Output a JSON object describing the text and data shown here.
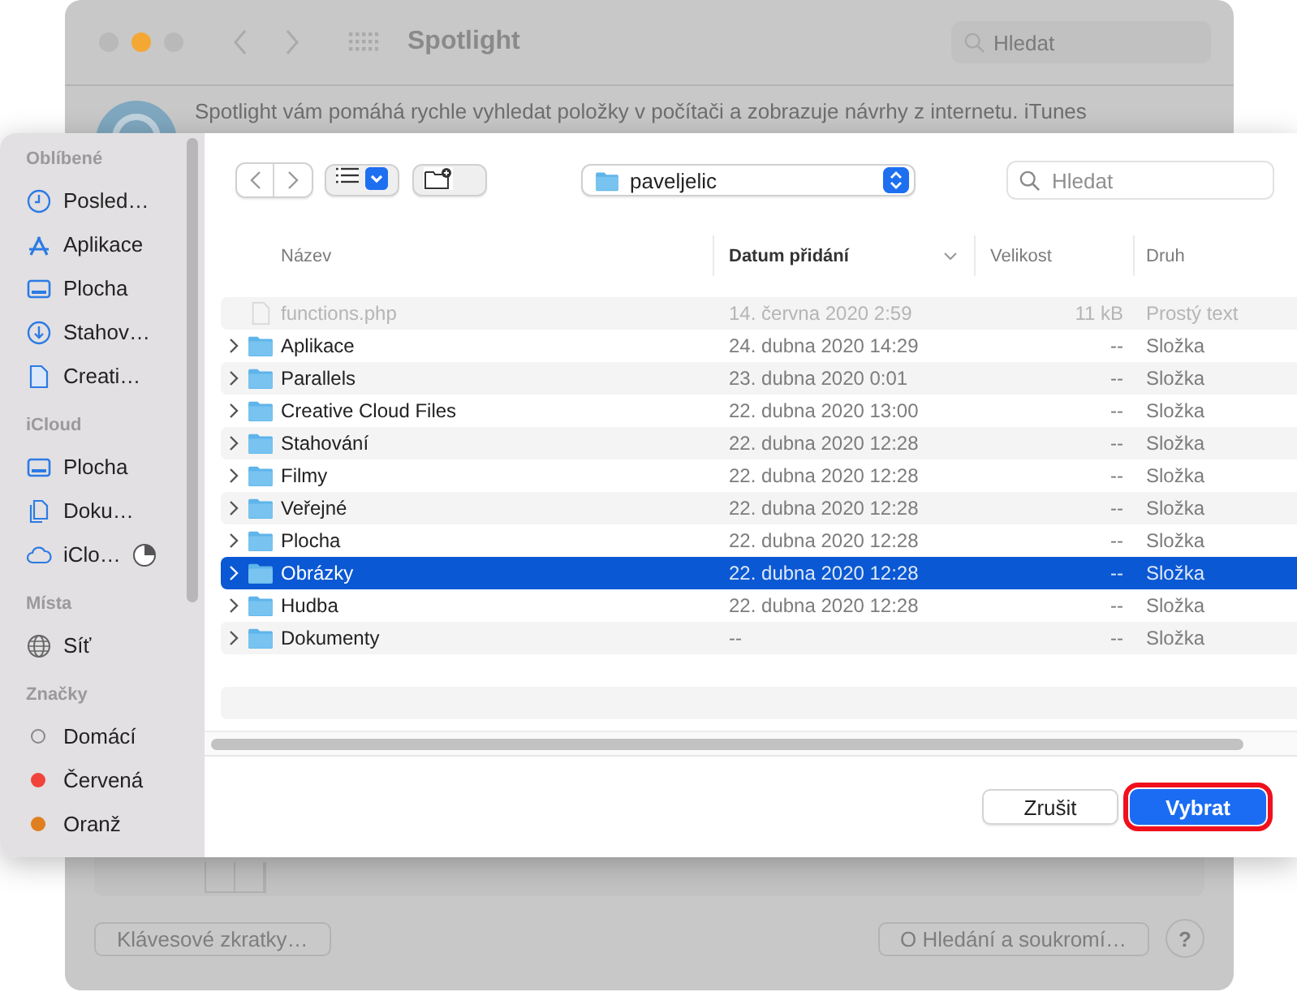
{
  "background_window": {
    "title": "Spotlight",
    "search": {
      "placeholder": "Hledat"
    },
    "description": "Spotlight vám pomáhá rychle vyhledat položky v počítači a zobrazuje návrhy z internetu. iTunes",
    "buttons": [
      "Klávesové zkratky…",
      "O Hledání a soukromí…"
    ],
    "help": "?"
  },
  "dialog": {
    "sidebar": {
      "sections": [
        {
          "title": "Oblíbené",
          "items": [
            {
              "label": "Posled…",
              "kind": "recent"
            },
            {
              "label": "Aplikace",
              "kind": "apps"
            },
            {
              "label": "Plocha",
              "kind": "desktop"
            },
            {
              "label": "Stahov…",
              "kind": "downloads"
            },
            {
              "label": "Creati…",
              "kind": "document"
            }
          ]
        },
        {
          "title": "iCloud",
          "items": [
            {
              "label": "Plocha",
              "kind": "desktop"
            },
            {
              "label": "Doku…",
              "kind": "documents"
            },
            {
              "label": "iClo…",
              "kind": "cloud"
            }
          ]
        },
        {
          "title": "Místa",
          "items": [
            {
              "label": "Síť",
              "kind": "network"
            }
          ]
        },
        {
          "title": "Značky",
          "items": [
            {
              "label": "Domácí",
              "kind": "tag"
            },
            {
              "label": "Červená",
              "kind": "tag",
              "color": "#f0443a"
            },
            {
              "label": "Oranž",
              "kind": "tag",
              "color": "#e07f1f"
            }
          ]
        }
      ]
    },
    "toolbar": {
      "location": "paveljelic",
      "search": {
        "placeholder": "Hledat"
      }
    },
    "table": {
      "columns": [
        {
          "label": "Název",
          "sorted": false
        },
        {
          "label": "Datum přidání",
          "sorted": true
        },
        {
          "label": "Velikost",
          "sorted": false
        },
        {
          "label": "Druh",
          "sorted": false
        }
      ],
      "rows": [
        {
          "name": "functions.php",
          "date": "14. června 2020 2:59",
          "size": "11 kB",
          "type": "Prostý text",
          "kind": "file",
          "disabled": true,
          "selected": false
        },
        {
          "name": "Aplikace",
          "date": "24. dubna 2020 14:29",
          "size": "--",
          "type": "Složka",
          "kind": "folder",
          "disabled": false,
          "selected": false
        },
        {
          "name": "Parallels",
          "date": "23. dubna 2020 0:01",
          "size": "--",
          "type": "Složka",
          "kind": "folder",
          "disabled": false,
          "selected": false
        },
        {
          "name": "Creative Cloud Files",
          "date": "22. dubna 2020 13:00",
          "size": "--",
          "type": "Složka",
          "kind": "folder",
          "disabled": false,
          "selected": false
        },
        {
          "name": "Stahování",
          "date": "22. dubna 2020 12:28",
          "size": "--",
          "type": "Složka",
          "kind": "folder",
          "disabled": false,
          "selected": false
        },
        {
          "name": "Filmy",
          "date": "22. dubna 2020 12:28",
          "size": "--",
          "type": "Složka",
          "kind": "folder",
          "disabled": false,
          "selected": false
        },
        {
          "name": "Veřejné",
          "date": "22. dubna 2020 12:28",
          "size": "--",
          "type": "Složka",
          "kind": "folder",
          "disabled": false,
          "selected": false
        },
        {
          "name": "Plocha",
          "date": "22. dubna 2020 12:28",
          "size": "--",
          "type": "Složka",
          "kind": "folder",
          "disabled": false,
          "selected": false
        },
        {
          "name": "Obrázky",
          "date": "22. dubna 2020 12:28",
          "size": "--",
          "type": "Složka",
          "kind": "folder",
          "disabled": false,
          "selected": true
        },
        {
          "name": "Hudba",
          "date": "22. dubna 2020 12:28",
          "size": "--",
          "type": "Složka",
          "kind": "folder",
          "disabled": false,
          "selected": false
        },
        {
          "name": "Dokumenty",
          "date": "--",
          "size": "--",
          "type": "Složka",
          "kind": "folder",
          "disabled": false,
          "selected": false
        }
      ]
    },
    "buttons": [
      {
        "label": "Zrušit",
        "default": false,
        "outlined": false
      },
      {
        "label": "Vybrat",
        "default": true,
        "outlined": true
      }
    ]
  }
}
